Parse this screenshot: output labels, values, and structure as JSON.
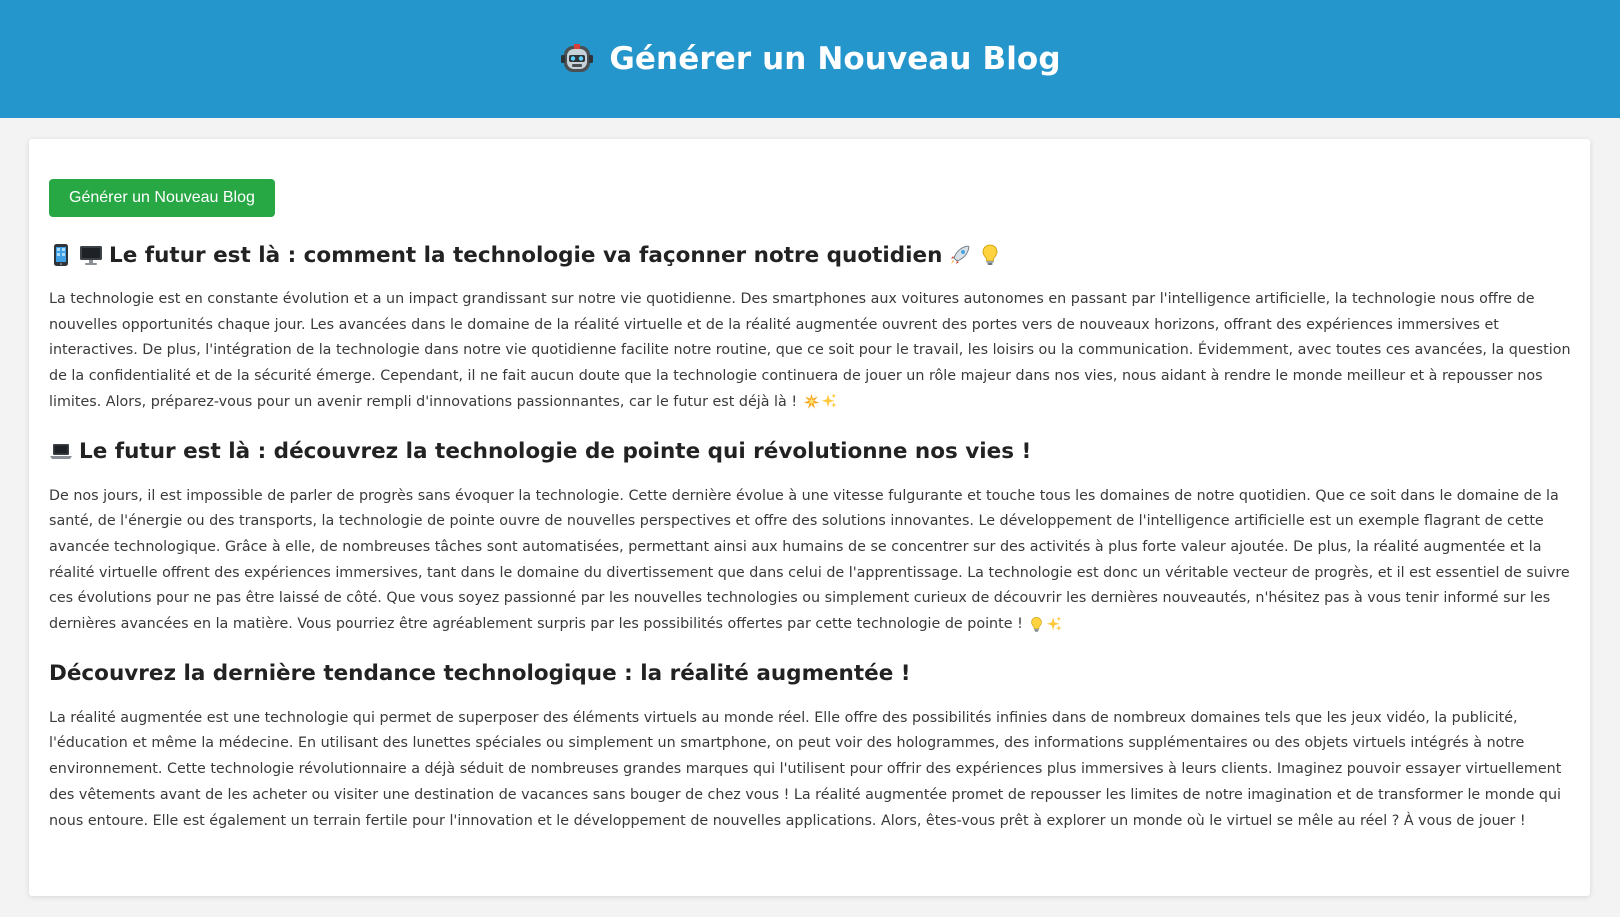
{
  "header": {
    "title": "Générer un Nouveau Blog",
    "icon": "robot-icon"
  },
  "actions": {
    "generate_label": "Générer un Nouveau Blog",
    "generate_color": "#28a745"
  },
  "colors": {
    "header_bg": "#2596cc",
    "page_bg": "#f3f3f3",
    "card_bg": "#ffffff"
  },
  "posts": [
    {
      "title_icons": [
        "mobile-phone-icon",
        "desktop-computer-icon"
      ],
      "title": "Le futur est là : comment la technologie va façonner notre quotidien",
      "title_end_icons": [
        "rocket-icon",
        "light-bulb-icon"
      ],
      "body": "La technologie est en constante évolution et a un impact grandissant sur notre vie quotidienne. Des smartphones aux voitures autonomes en passant par l'intelligence artificielle, la technologie nous offre de nouvelles opportunités chaque jour. Les avancées dans le domaine de la réalité virtuelle et de la réalité augmentée ouvrent des portes vers de nouveaux horizons, offrant des expériences immersives et interactives. De plus, l'intégration de la technologie dans notre vie quotidienne facilite notre routine, que ce soit pour le travail, les loisirs ou la communication. Évidemment, avec toutes ces avancées, la question de la confidentialité et de la sécurité émerge. Cependant, il ne fait aucun doute que la technologie continuera de jouer un rôle majeur dans nos vies, nous aidant à rendre le monde meilleur et à repousser nos limites. Alors, préparez-vous pour un avenir rempli d'innovations passionnantes, car le futur est déjà là !",
      "body_end_icons": [
        "collision-icon",
        "sparkles-icon"
      ]
    },
    {
      "title_icons": [
        "laptop-icon"
      ],
      "title": "Le futur est là : découvrez la technologie de pointe qui révolutionne nos vies !",
      "title_end_icons": [],
      "body": "De nos jours, il est impossible de parler de progrès sans évoquer la technologie. Cette dernière évolue à une vitesse fulgurante et touche tous les domaines de notre quotidien. Que ce soit dans le domaine de la santé, de l'énergie ou des transports, la technologie de pointe ouvre de nouvelles perspectives et offre des solutions innovantes. Le développement de l'intelligence artificielle est un exemple flagrant de cette avancée technologique. Grâce à elle, de nombreuses tâches sont automatisées, permettant ainsi aux humains de se concentrer sur des activités à plus forte valeur ajoutée. De plus, la réalité augmentée et la réalité virtuelle offrent des expériences immersives, tant dans le domaine du divertissement que dans celui de l'apprentissage. La technologie est donc un véritable vecteur de progrès, et il est essentiel de suivre ces évolutions pour ne pas être laissé de côté. Que vous soyez passionné par les nouvelles technologies ou simplement curieux de découvrir les dernières nouveautés, n'hésitez pas à vous tenir informé sur les dernières avancées en la matière. Vous pourriez être agréablement surpris par les possibilités offertes par cette technologie de pointe !",
      "body_end_icons": [
        "light-bulb-icon",
        "sparkles-icon"
      ]
    },
    {
      "title_icons": [],
      "title": "Découvrez la dernière tendance technologique : la réalité augmentée !",
      "title_end_icons": [],
      "body": "La réalité augmentée est une technologie qui permet de superposer des éléments virtuels au monde réel. Elle offre des possibilités infinies dans de nombreux domaines tels que les jeux vidéo, la publicité, l'éducation et même la médecine. En utilisant des lunettes spéciales ou simplement un smartphone, on peut voir des hologrammes, des informations supplémentaires ou des objets virtuels intégrés à notre environnement. Cette technologie révolutionnaire a déjà séduit de nombreuses grandes marques qui l'utilisent pour offrir des expériences plus immersives à leurs clients. Imaginez pouvoir essayer virtuellement des vêtements avant de les acheter ou visiter une destination de vacances sans bouger de chez vous ! La réalité augmentée promet de repousser les limites de notre imagination et de transformer le monde qui nous entoure. Elle est également un terrain fertile pour l'innovation et le développement de nouvelles applications. Alors, êtes-vous prêt à explorer un monde où le virtuel se mêle au réel ? À vous de jouer !",
      "body_end_icons": []
    }
  ]
}
